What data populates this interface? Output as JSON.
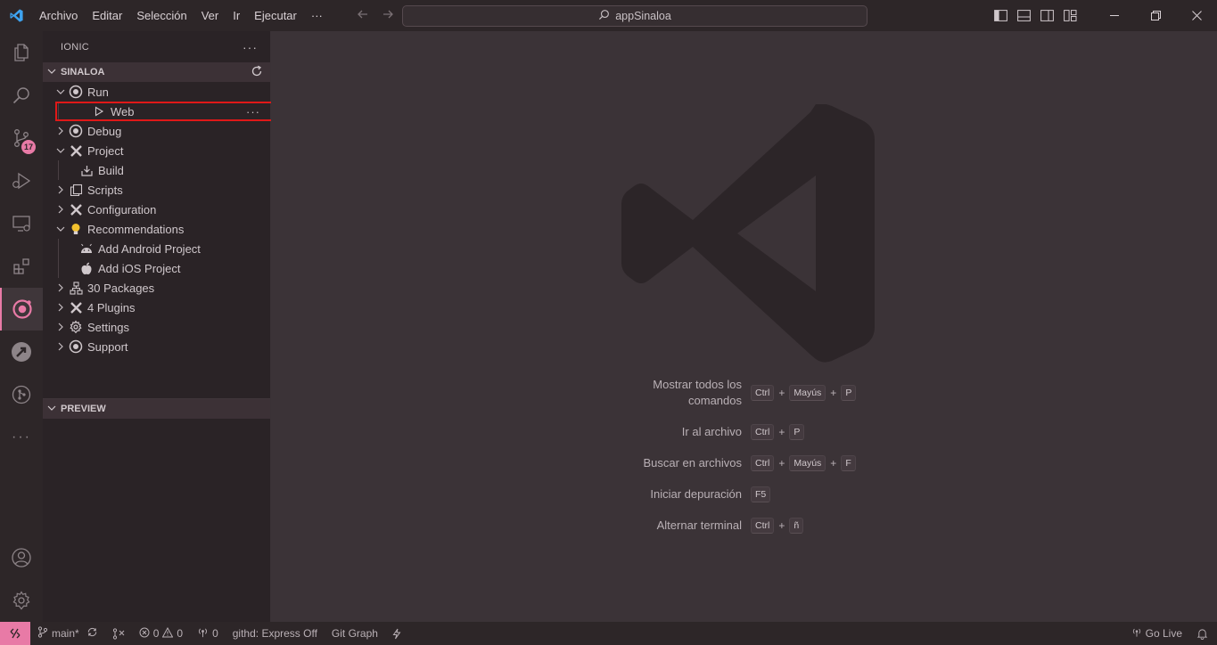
{
  "titlebar": {
    "menu": [
      "Archivo",
      "Editar",
      "Selección",
      "Ver",
      "Ir",
      "Ejecutar"
    ],
    "more": "···",
    "search_text": "appSinaloa"
  },
  "activitybar": {
    "scm_badge": "17"
  },
  "sidebar": {
    "title": "IONIC",
    "title_more": "···",
    "section_label": "SINALOA",
    "items": [
      {
        "label": "Run"
      },
      {
        "label": "Web",
        "more": "···"
      },
      {
        "label": "Debug"
      },
      {
        "label": "Project"
      },
      {
        "label": "Build"
      },
      {
        "label": "Scripts"
      },
      {
        "label": "Configuration"
      },
      {
        "label": "Recommendations"
      },
      {
        "label": "Add Android Project"
      },
      {
        "label": "Add iOS Project"
      },
      {
        "label": "30 Packages"
      },
      {
        "label": "4 Plugins"
      },
      {
        "label": "Settings"
      },
      {
        "label": "Support"
      }
    ],
    "preview_label": "PREVIEW"
  },
  "editor": {
    "shortcuts": [
      {
        "label": "Mostrar todos los comandos",
        "keys": [
          "Ctrl",
          "Mayús",
          "P"
        ]
      },
      {
        "label": "Ir al archivo",
        "keys": [
          "Ctrl",
          "P"
        ]
      },
      {
        "label": "Buscar en archivos",
        "keys": [
          "Ctrl",
          "Mayús",
          "F"
        ]
      },
      {
        "label": "Iniciar depuración",
        "keys": [
          "F5"
        ]
      },
      {
        "label": "Alternar terminal",
        "keys": [
          "Ctrl",
          "ñ"
        ]
      }
    ]
  },
  "statusbar": {
    "branch": "main*",
    "errors": "0",
    "warnings": "0",
    "ports": "0",
    "githd": "githd: Express Off",
    "git_graph": "Git Graph",
    "go_live": "Go Live"
  },
  "colors": {
    "accent": "#e87aa6",
    "selection_outline": "#e01818",
    "bg_editor": "#3b3337",
    "bg_sidebar": "#2a2326"
  }
}
